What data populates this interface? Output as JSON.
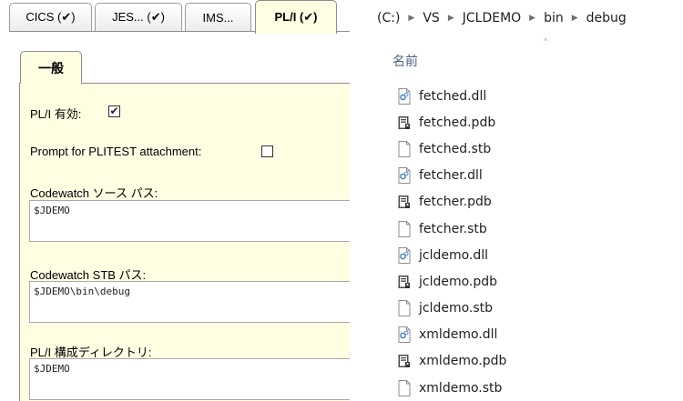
{
  "left_panel": {
    "tabs": [
      {
        "label": "CICS (✔)"
      },
      {
        "label": "JES... (✔)"
      },
      {
        "label": "IMS..."
      },
      {
        "label": "PL/I (✔)"
      }
    ],
    "subtab": "一般",
    "pli_enabled": {
      "label": "PL/I 有効:",
      "checked": true,
      "mark": "✔"
    },
    "plitest_prompt": {
      "label": "Prompt for PLITEST attachment:",
      "checked": false,
      "mark": ""
    },
    "codewatch_source": {
      "label": "Codewatch ソース パス:",
      "value": "$JDEMO"
    },
    "codewatch_stb": {
      "label": "Codewatch STB パス:",
      "value": "$JDEMO\\bin\\debug"
    },
    "pli_config_dir": {
      "label": "PL/I 構成ディレクトリ:",
      "value": "$JDEMO"
    }
  },
  "explorer": {
    "breadcrumb": [
      "(C:)",
      "VS",
      "JCLDEMO",
      "bin",
      "debug"
    ],
    "separator": "▶",
    "sort_indicator": "^",
    "column_header": "名前",
    "files": [
      {
        "name": "fetched.dll",
        "icon": "dll-file-icon"
      },
      {
        "name": "fetched.pdb",
        "icon": "pdb-file-icon"
      },
      {
        "name": "fetched.stb",
        "icon": "blank-file-icon"
      },
      {
        "name": "fetcher.dll",
        "icon": "dll-file-icon"
      },
      {
        "name": "fetcher.pdb",
        "icon": "pdb-file-icon"
      },
      {
        "name": "fetcher.stb",
        "icon": "blank-file-icon"
      },
      {
        "name": "jcldemo.dll",
        "icon": "dll-file-icon"
      },
      {
        "name": "jcldemo.pdb",
        "icon": "pdb-file-icon"
      },
      {
        "name": "jcldemo.stb",
        "icon": "blank-file-icon"
      },
      {
        "name": "xmldemo.dll",
        "icon": "dll-file-icon"
      },
      {
        "name": "xmldemo.pdb",
        "icon": "pdb-file-icon"
      },
      {
        "name": "xmldemo.stb",
        "icon": "blank-file-icon"
      }
    ]
  },
  "colors": {
    "panel_bg": "#fffde2",
    "header_text": "#4c607a"
  }
}
